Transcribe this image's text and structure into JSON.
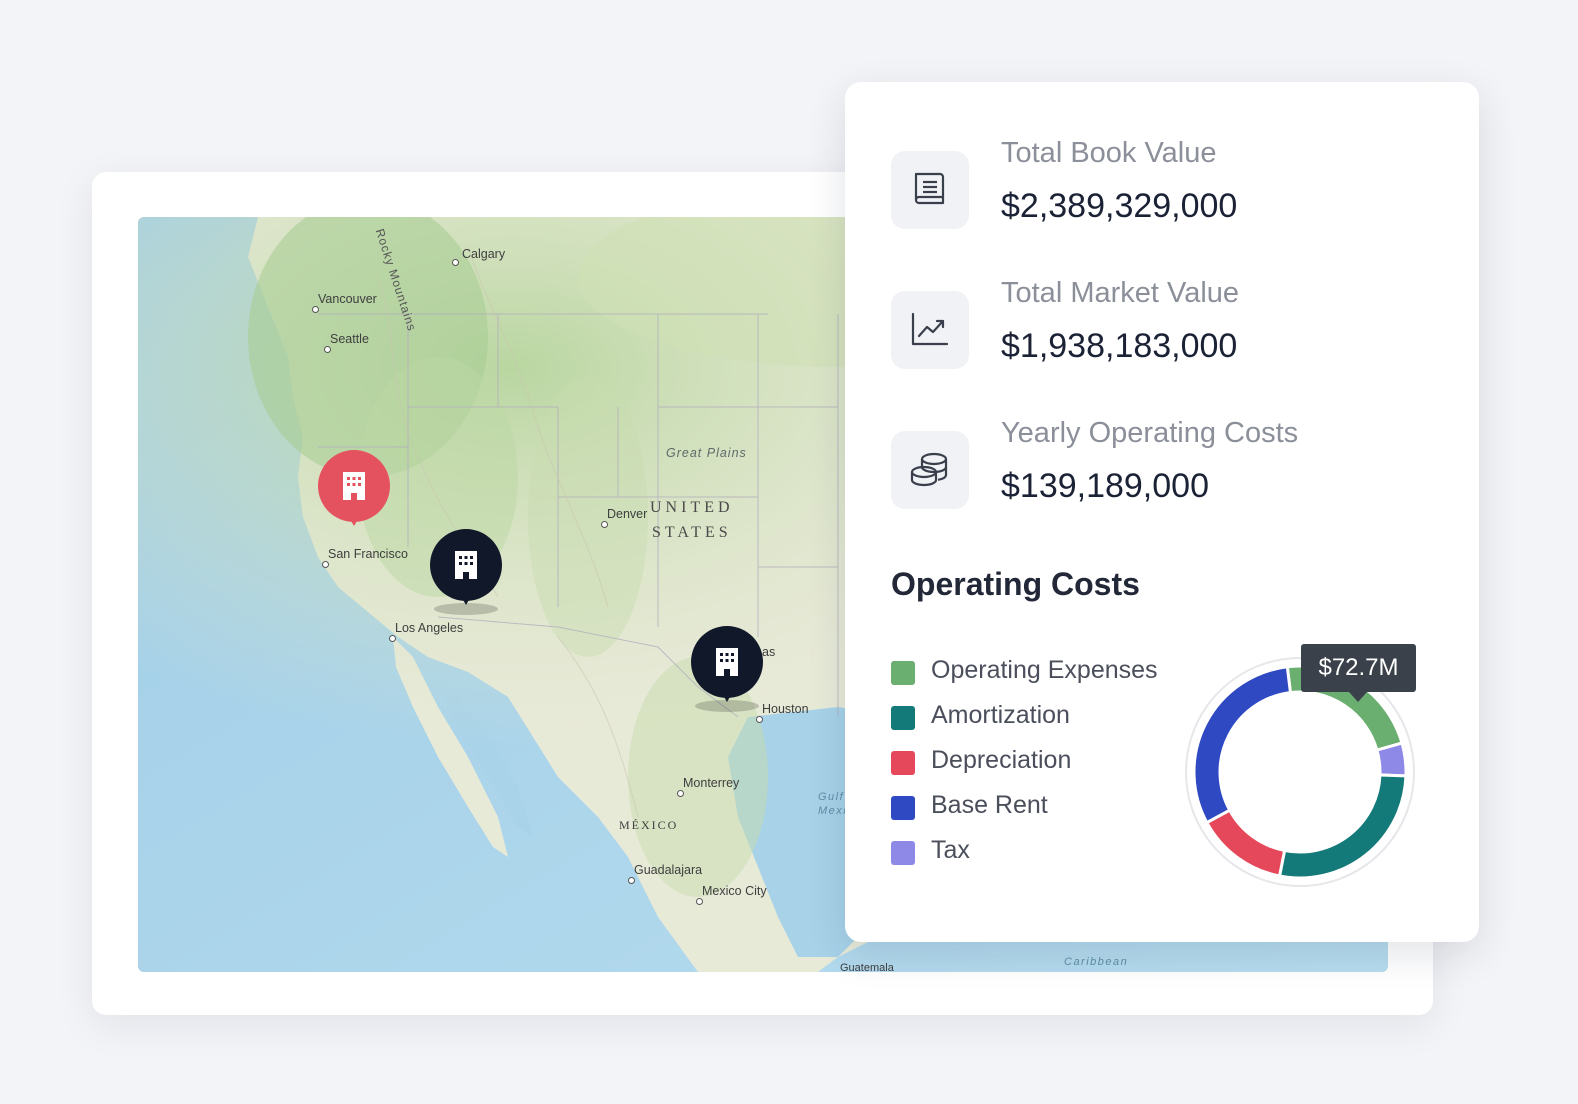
{
  "map": {
    "labels": {
      "calgary": "Calgary",
      "vancouver": "Vancouver",
      "seattle": "Seattle",
      "rocky_mountains": "Rocky Mountains",
      "great_plains": "Great Plains",
      "denver": "Denver",
      "united": "UNITED",
      "states": "STATES",
      "san_francisco": "San Francisco",
      "los_angeles": "Los Angeles",
      "dallas_partial": "as",
      "houston": "Houston",
      "monterrey": "Monterrey",
      "mexico": "MÉXICO",
      "guadalajara": "Guadalajara",
      "mexico_city": "Mexico City",
      "gulf_line1": "Gulf",
      "gulf_line2": "Mexi",
      "guatemala": "Guatemala",
      "caribbean": "Caribbean"
    },
    "pins": [
      {
        "name": "San Francisco area building",
        "color": "#e5525f",
        "icon": "building-icon"
      },
      {
        "name": "Nevada building",
        "color": "#111829",
        "icon": "building-icon"
      },
      {
        "name": "Texas building",
        "color": "#111829",
        "icon": "building-icon"
      }
    ]
  },
  "stats": [
    {
      "label": "Total Book Value",
      "value": "$2,389,329,000",
      "icon": "book-icon"
    },
    {
      "label": "Total Market Value",
      "value": "$1,938,183,000",
      "icon": "chart-up-icon"
    },
    {
      "label": "Yearly Operating Costs",
      "value": "$139,189,000",
      "icon": "coins-icon"
    }
  ],
  "operating_costs": {
    "title": "Operating Costs",
    "tooltip": "$72.7M",
    "legend": [
      {
        "label": "Operating Expenses",
        "color": "#6aae70"
      },
      {
        "label": "Amortization",
        "color": "#137a79"
      },
      {
        "label": "Depreciation",
        "color": "#e5485a"
      },
      {
        "label": "Base Rent",
        "color": "#2f49c2"
      },
      {
        "label": "Tax",
        "color": "#8e89e6"
      }
    ]
  },
  "chart_data": {
    "type": "pie",
    "categories": [
      "Operating Expenses",
      "Amortization",
      "Depreciation",
      "Base Rent",
      "Tax"
    ],
    "values": [
      22.5,
      27.5,
      14,
      31,
      5
    ],
    "colors": [
      "#6aae70",
      "#137a79",
      "#e5485a",
      "#2f49c2",
      "#8e89e6"
    ],
    "donut": true,
    "annotations": [
      "$72.7M"
    ]
  }
}
